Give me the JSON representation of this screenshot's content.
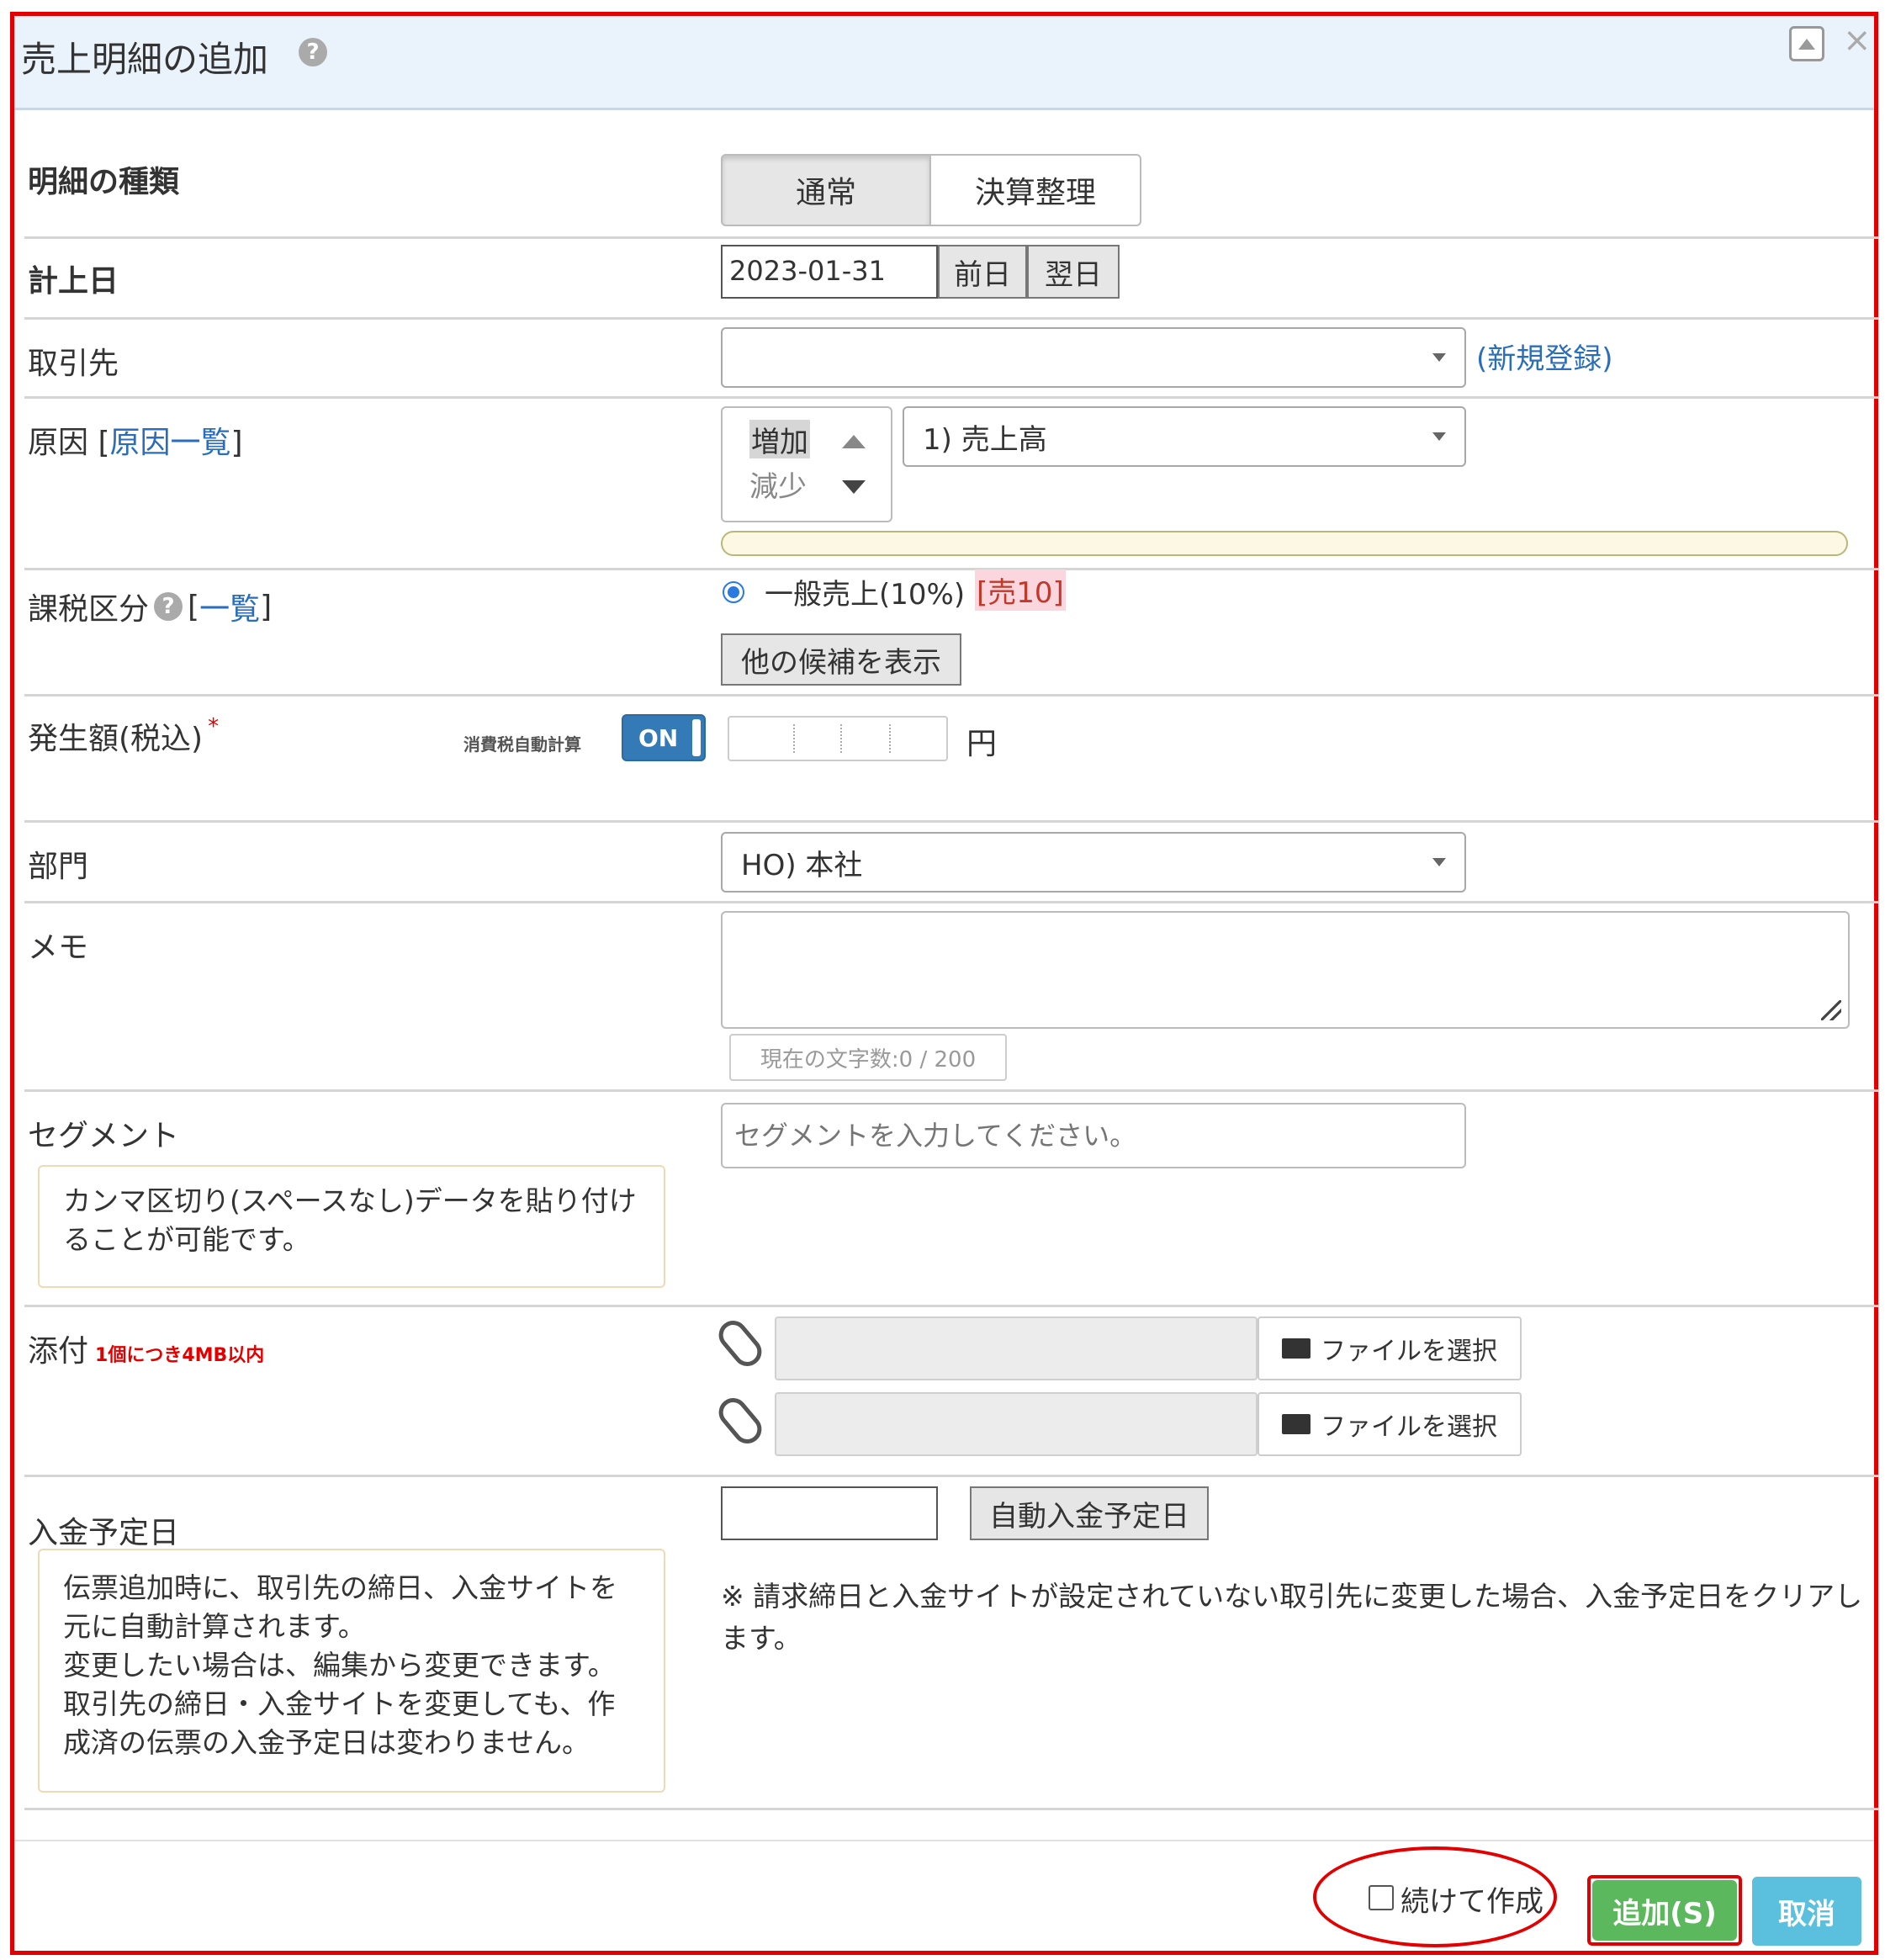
{
  "dialog": {
    "title": "売上明細の追加",
    "icons": {
      "help": "help-circle-icon",
      "maximize": "maximize-icon",
      "close": "close-icon"
    }
  },
  "detail_type": {
    "label": "明細の種類",
    "options": [
      "通常",
      "決算整理"
    ],
    "selected": "通常"
  },
  "record_date": {
    "label": "計上日",
    "value": "2023-01-31",
    "prev": "前日",
    "next": "翌日"
  },
  "partner": {
    "label": "取引先",
    "value": "",
    "register_link": "(新規登録)"
  },
  "cause": {
    "label": "原因 [",
    "list_link": "原因一覧",
    "bracket_close": "]",
    "spinner_options": [
      "増加",
      "減少"
    ],
    "selected_option": "増加",
    "value": "1) 売上高"
  },
  "tax_class": {
    "label": "課税区分",
    "list_open": "[",
    "list_link": "一覧",
    "list_close": "]",
    "option_label": "一般売上(10%)",
    "option_tag": "[売10]",
    "show_more": "他の候補を表示"
  },
  "amount": {
    "label": "発生額(税込)",
    "required_mark": "*",
    "auto_tax_label": "消費税自動計算",
    "toggle": "ON",
    "unit": "円",
    "value": ""
  },
  "department": {
    "label": "部門",
    "value": "HO) 本社"
  },
  "memo": {
    "label": "メモ",
    "value": "",
    "char_count": "現在の文字数:0 / 200"
  },
  "segment": {
    "label": "セグメント",
    "placeholder": "セグメントを入力してください。",
    "note": "カンマ区切り(スペースなし)データを貼り付けることが可能です。"
  },
  "attachment": {
    "label": "添付",
    "limit": "1個につき4MB以内",
    "choose_file": "ファイルを選択"
  },
  "payment_date": {
    "label": "入金予定日",
    "value": "",
    "auto_button": "自動入金予定日",
    "note_lines": [
      "伝票追加時に、取引先の締日、入金サイトを元に自動計算されます。",
      "変更したい場合は、編集から変更できます。",
      "取引先の締日・入金サイトを変更しても、作成済の伝票の入金予定日は変わりません。"
    ],
    "remark": "※ 請求締日と入金サイトが設定されていない取引先に変更した場合、入金予定日をクリアします。"
  },
  "footer": {
    "continue_label": "続けて作成",
    "add_button": "追加(S)",
    "cancel_button": "取消"
  },
  "colors": {
    "highlight": "#e30000",
    "add_green": "#5cb85c",
    "cancel_blue": "#5bc0de",
    "toggle_blue": "#337ab7",
    "link_blue": "#2a6ebb",
    "note_border": "#f0d9b5",
    "pale_yellow": "#fcf8e3"
  }
}
